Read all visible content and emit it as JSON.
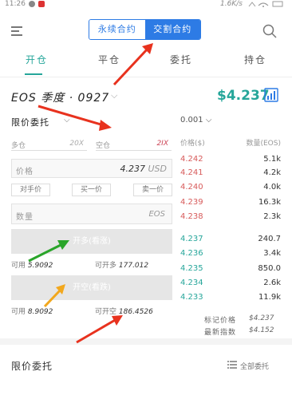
{
  "status_bar": {
    "time": "11:26",
    "speed": "1.6K/s",
    "dot_colors": [
      "#888888",
      "#d33333"
    ]
  },
  "header": {
    "segment_perpetual": "永续合约",
    "segment_delivery": "交割合约",
    "active_segment": "交割合约"
  },
  "tabs": [
    {
      "label": "开仓",
      "active": true
    },
    {
      "label": "平仓",
      "active": false
    },
    {
      "label": "委托",
      "active": false
    },
    {
      "label": "持仓",
      "active": false
    }
  ],
  "contract": {
    "name": "EOS 季度 · 0927",
    "price": "$4.237"
  },
  "order_form": {
    "order_type": "限价委托",
    "long_leverage": {
      "label": "多仓",
      "value": "20X"
    },
    "short_leverage": {
      "label": "空仓",
      "value": "2IX"
    },
    "price": {
      "label": "价格",
      "value": "4.237",
      "unit": "USD"
    },
    "quick_buttons": [
      "对手价",
      "买一价",
      "卖一价"
    ],
    "quantity": {
      "label": "数量",
      "unit": "EOS"
    },
    "open_long": "开多(看涨)",
    "open_short": "开空(看跌)",
    "long_available": {
      "label": "可用",
      "value": "5.9092"
    },
    "long_openable": {
      "label": "可开多",
      "value": "177.012"
    },
    "short_available": {
      "label": "可用",
      "value": "8.9092"
    },
    "short_openable": {
      "label": "可开空",
      "value": "186.4526"
    }
  },
  "order_book": {
    "depth": "0.001",
    "price_header": "价格($)",
    "qty_header": "数量(EOS)",
    "asks": [
      {
        "price": "4.242",
        "qty": "5.1k"
      },
      {
        "price": "4.241",
        "qty": "4.2k"
      },
      {
        "price": "4.240",
        "qty": "4.0k"
      },
      {
        "price": "4.239",
        "qty": "16.3k"
      },
      {
        "price": "4.238",
        "qty": "2.3k"
      }
    ],
    "bids": [
      {
        "price": "4.237",
        "qty": "240.7"
      },
      {
        "price": "4.236",
        "qty": "3.4k"
      },
      {
        "price": "4.235",
        "qty": "850.0"
      },
      {
        "price": "4.234",
        "qty": "2.6k"
      },
      {
        "price": "4.233",
        "qty": "11.9k"
      }
    ],
    "mark_price": {
      "label": "标记价格",
      "value": "$4.237"
    },
    "max_drawdown": {
      "label": "最新指数",
      "value": "$4.152"
    }
  },
  "orders_section": {
    "title": "限价委托",
    "all_orders": "全部委托"
  },
  "colors": {
    "accent_blue": "#2d7be5",
    "green": "#26a69a",
    "red": "#d75a5a",
    "arrow_red": "#e8321e",
    "arrow_green": "#2aa52a",
    "arrow_orange": "#f2a81e"
  }
}
